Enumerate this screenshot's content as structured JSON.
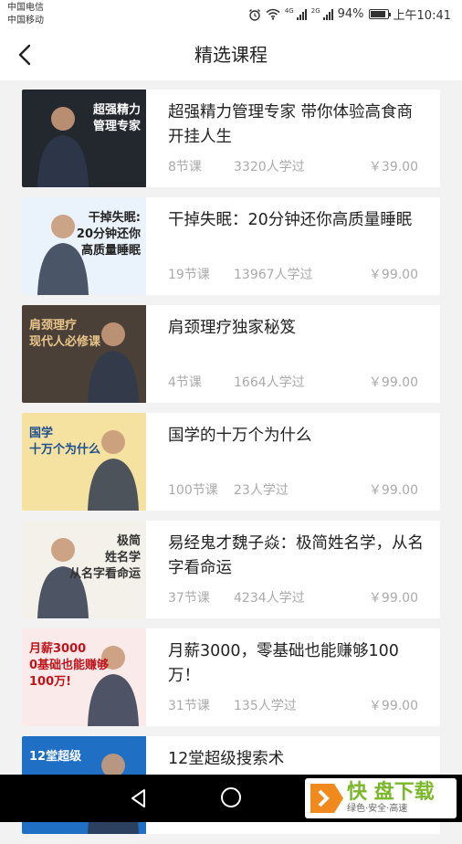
{
  "statusbar": {
    "carrier1": "中国电信",
    "carrier2": "中国移动",
    "net1": "4G",
    "net2": "2G",
    "battery": "94%",
    "battery_level": 0.94,
    "time": "上午10:41"
  },
  "header": {
    "title": "精选课程"
  },
  "courses": [
    {
      "title": "超强精力管理专家 带你体验高食商开挂人生",
      "lessons": "8节课",
      "learners": "3320人学过",
      "price": "￥39.00",
      "thumb_lines": [
        "超强精力",
        "管理专家"
      ],
      "thumb_bg": "#23272e",
      "thumb_fg": "#ffffff"
    },
    {
      "title": "干掉失眠：20分钟还你高质量睡眠",
      "lessons": "19节课",
      "learners": "13967人学过",
      "price": "￥99.00",
      "thumb_lines": [
        "干掉失眠:",
        "20分钟还你",
        "高质量睡眠"
      ],
      "thumb_bg": "#eaf2fb",
      "thumb_fg": "#222222"
    },
    {
      "title": "肩颈理疗独家秘笈",
      "lessons": "4节课",
      "learners": "1664人学过",
      "price": "￥99.00",
      "thumb_lines": [
        "肩颈理疗",
        "现代人必修课"
      ],
      "thumb_bg": "#4a4038",
      "thumb_fg": "#e9c58a"
    },
    {
      "title": "国学的十万个为什么",
      "lessons": "100节课",
      "learners": "23人学过",
      "price": "￥99.00",
      "thumb_lines": [
        "国学",
        "十万个为什么"
      ],
      "thumb_bg": "#f6e2a0",
      "thumb_fg": "#1b4f8f"
    },
    {
      "title": "易经鬼才魏子焱：极简姓名学，从名字看命运",
      "lessons": "37节课",
      "learners": "4234人学过",
      "price": "￥99.00",
      "thumb_lines": [
        "极简",
        "姓名学",
        "从名字看命运"
      ],
      "thumb_bg": "#f4f1ea",
      "thumb_fg": "#333333"
    },
    {
      "title": "月薪3000，零基础也能赚够100万！",
      "lessons": "31节课",
      "learners": "135人学过",
      "price": "￥99.00",
      "thumb_lines": [
        "月薪3000",
        "0基础也能赚够",
        "100万!"
      ],
      "thumb_bg": "#fbeaea",
      "thumb_fg": "#c0141b"
    },
    {
      "title": "12堂超级搜索术",
      "lessons": "",
      "learners": "",
      "price": "",
      "thumb_lines": [
        "12堂超级"
      ],
      "thumb_bg": "#1f6fc5",
      "thumb_fg": "#ffffff"
    }
  ],
  "watermark": {
    "main": "快 盘下载",
    "sub": "绿色·安全·高速"
  },
  "colors": {
    "accent": "#7ab82a",
    "background": "#f2f2f2",
    "meta": "#aaaaaa"
  }
}
